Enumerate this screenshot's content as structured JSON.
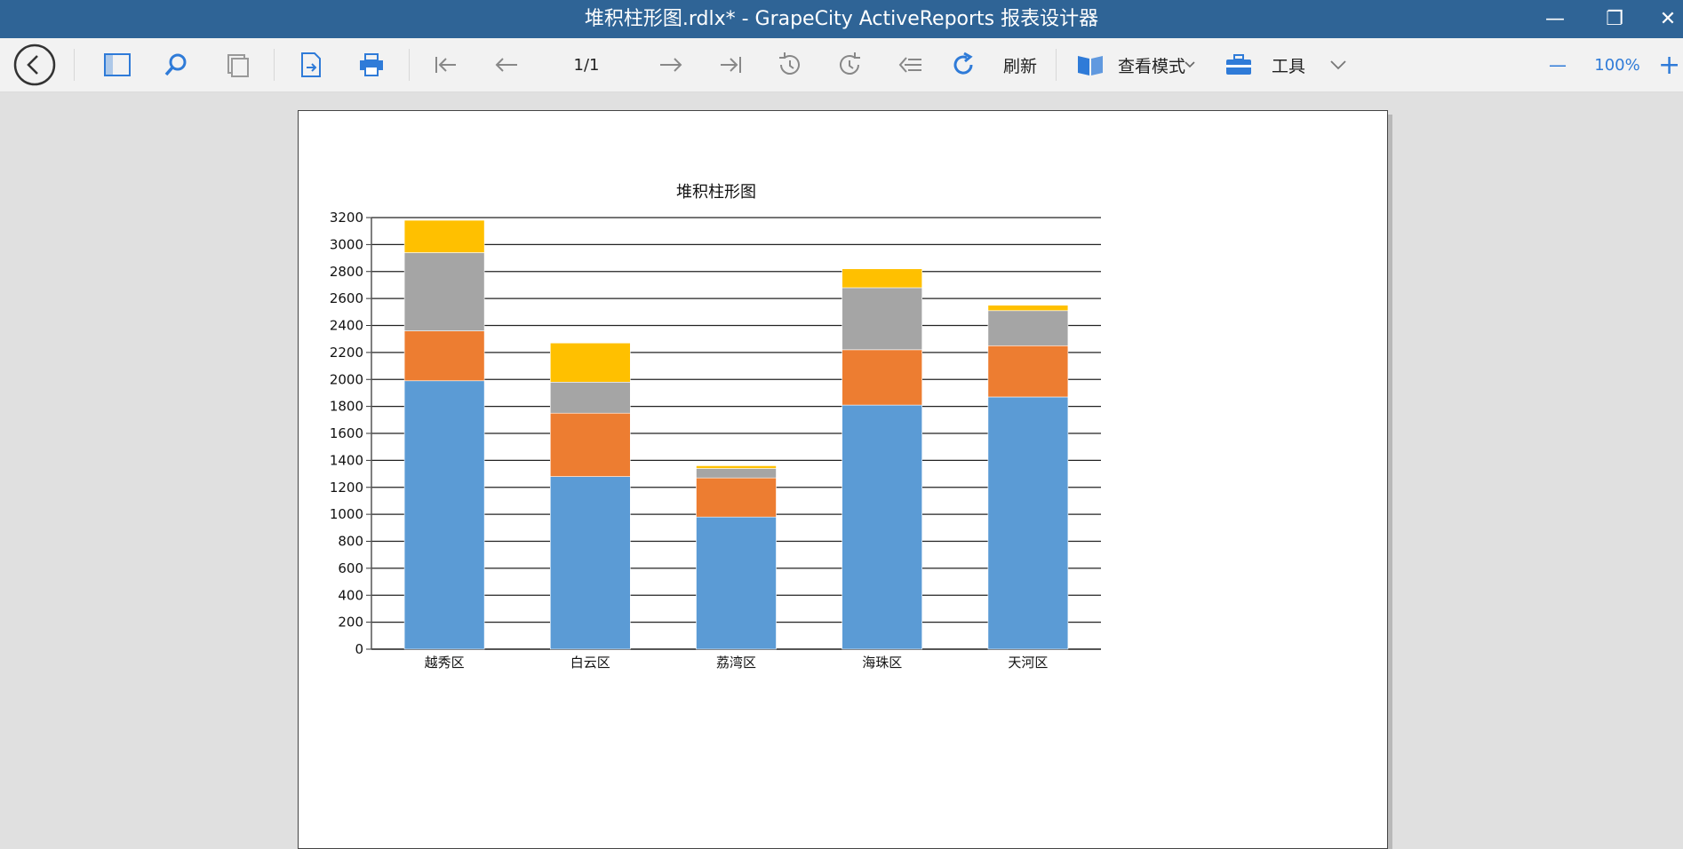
{
  "window": {
    "title": "堆积柱形图.rdlx* - GrapeCity ActiveReports 报表设计器",
    "minimize_glyph": "—",
    "restore_glyph": "❐",
    "close_glyph": "✕"
  },
  "toolbar": {
    "page_indicator": "1/1",
    "refresh_label": "刷新",
    "view_mode_label": "查看模式",
    "tools_label": "工具",
    "zoom_level": "100%",
    "zoom_out_glyph": "—",
    "zoom_in_glyph": "+",
    "icons": [
      "back-icon",
      "sidebar-toggle-icon",
      "search-icon",
      "thumbnails-icon",
      "export-icon",
      "print-icon",
      "first-page-icon",
      "prev-page-icon",
      "next-page-icon",
      "last-page-icon",
      "history-back-icon",
      "history-forward-icon",
      "back-to-parent-icon",
      "refresh-icon",
      "book-icon",
      "toolbox-icon",
      "chevron-down-icon"
    ]
  },
  "chart_data": {
    "type": "bar",
    "stacked": true,
    "title": "堆积柱形图",
    "categories": [
      "越秀区",
      "白云区",
      "荔湾区",
      "海珠区",
      "天河区"
    ],
    "series": [
      {
        "color": "#5b9bd5",
        "values": [
          1990,
          1280,
          980,
          1810,
          1870
        ]
      },
      {
        "color": "#ed7d31",
        "values": [
          370,
          470,
          290,
          410,
          380
        ]
      },
      {
        "color": "#a5a5a5",
        "values": [
          580,
          230,
          70,
          460,
          260
        ]
      },
      {
        "color": "#ffc000",
        "values": [
          240,
          290,
          20,
          140,
          40
        ]
      }
    ],
    "y_ticks": [
      "0",
      "200",
      "400",
      "600",
      "800",
      "1000",
      "1200",
      "1400",
      "1600",
      "1800",
      "2000",
      "2200",
      "2400",
      "2600",
      "2800",
      "3000",
      "3200"
    ],
    "ylim": [
      0,
      3200
    ],
    "grid": true
  }
}
